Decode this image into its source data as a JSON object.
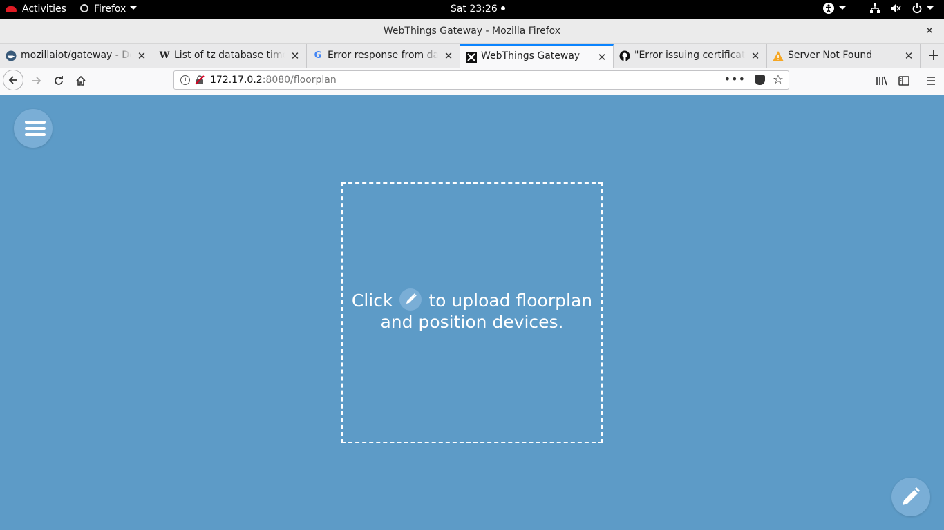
{
  "gnome": {
    "activities": "Activities",
    "app_menu": "Firefox",
    "clock": "Sat 23:26"
  },
  "window": {
    "title": "WebThings Gateway - Mozilla Firefox"
  },
  "tabs": [
    {
      "label": "mozillaiot/gateway - Docker Hub",
      "icon": "docker-icon"
    },
    {
      "label": "List of tz database time zones",
      "icon": "wikipedia-icon"
    },
    {
      "label": "Error response from daemon",
      "icon": "google-icon"
    },
    {
      "label": "WebThings Gateway",
      "icon": "webthings-icon",
      "active": true
    },
    {
      "label": "\"Error issuing certificate\"",
      "icon": "github-icon"
    },
    {
      "label": "Server Not Found",
      "icon": "warning-icon"
    }
  ],
  "navbar": {
    "url_host": "172.17.0.2",
    "url_rest": ":8080/floorplan"
  },
  "page": {
    "prompt_before": "Click",
    "prompt_after": "to upload floorplan",
    "prompt_line2": "and position devices.",
    "background_color": "#5d9bc7"
  }
}
